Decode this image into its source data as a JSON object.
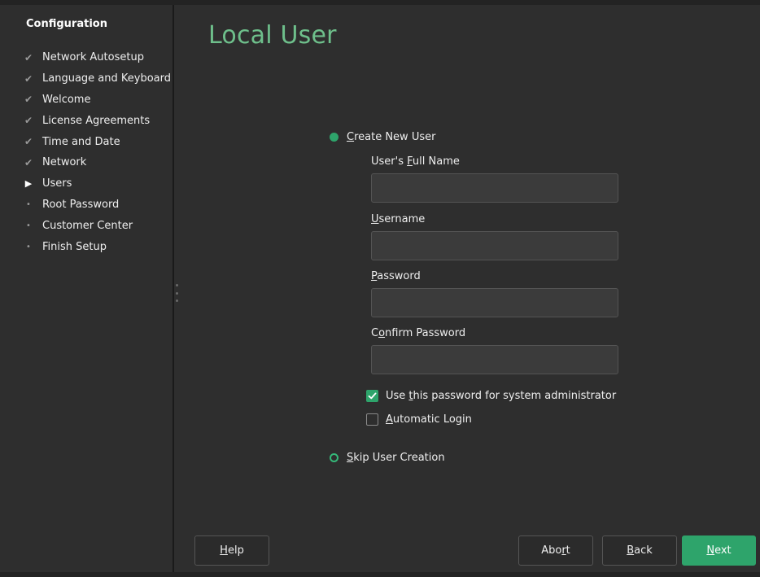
{
  "sidebar": {
    "title": "Configuration",
    "steps": [
      {
        "label": "Network Autosetup",
        "state": "done"
      },
      {
        "label": "Language and Keyboard",
        "state": "done"
      },
      {
        "label": "Welcome",
        "state": "done"
      },
      {
        "label": "License Agreements",
        "state": "done"
      },
      {
        "label": "Time and Date",
        "state": "done"
      },
      {
        "label": "Network",
        "state": "done"
      },
      {
        "label": "Users",
        "state": "current"
      },
      {
        "label": "Root Password",
        "state": "pending"
      },
      {
        "label": "Customer Center",
        "state": "pending"
      },
      {
        "label": "Finish Setup",
        "state": "pending"
      }
    ]
  },
  "page": {
    "title": "Local User"
  },
  "form": {
    "create_option": {
      "pre": "",
      "key": "C",
      "post": "reate New User",
      "selected": true
    },
    "full_name": {
      "pre": "User's ",
      "key": "F",
      "post": "ull Name",
      "value": ""
    },
    "username": {
      "pre": "",
      "key": "U",
      "post": "sername",
      "value": ""
    },
    "password": {
      "pre": "",
      "key": "P",
      "post": "assword",
      "value": ""
    },
    "confirm": {
      "pre": "C",
      "key": "o",
      "post": "nfirm Password",
      "value": ""
    },
    "admin_checkbox": {
      "pre": "Use ",
      "key": "t",
      "post": "his password for system administrator",
      "checked": true
    },
    "autologin_checkbox": {
      "pre": "",
      "key": "A",
      "post": "utomatic Login",
      "checked": false
    },
    "skip_option": {
      "pre": "",
      "key": "S",
      "post": "kip User Creation",
      "selected": false
    }
  },
  "buttons": {
    "help": {
      "pre": "",
      "key": "H",
      "post": "elp"
    },
    "abort": {
      "pre": "Abo",
      "key": "r",
      "post": "t"
    },
    "back": {
      "pre": "",
      "key": "B",
      "post": "ack"
    },
    "next": {
      "pre": "",
      "key": "N",
      "post": "ext"
    }
  },
  "icons": {
    "done": "checkmark-icon",
    "current": "triangle-right-icon",
    "pending": "bullet-icon"
  },
  "colors": {
    "accent": "#2ea46b",
    "title": "#6ebf8b",
    "background": "#2e2e2e"
  }
}
